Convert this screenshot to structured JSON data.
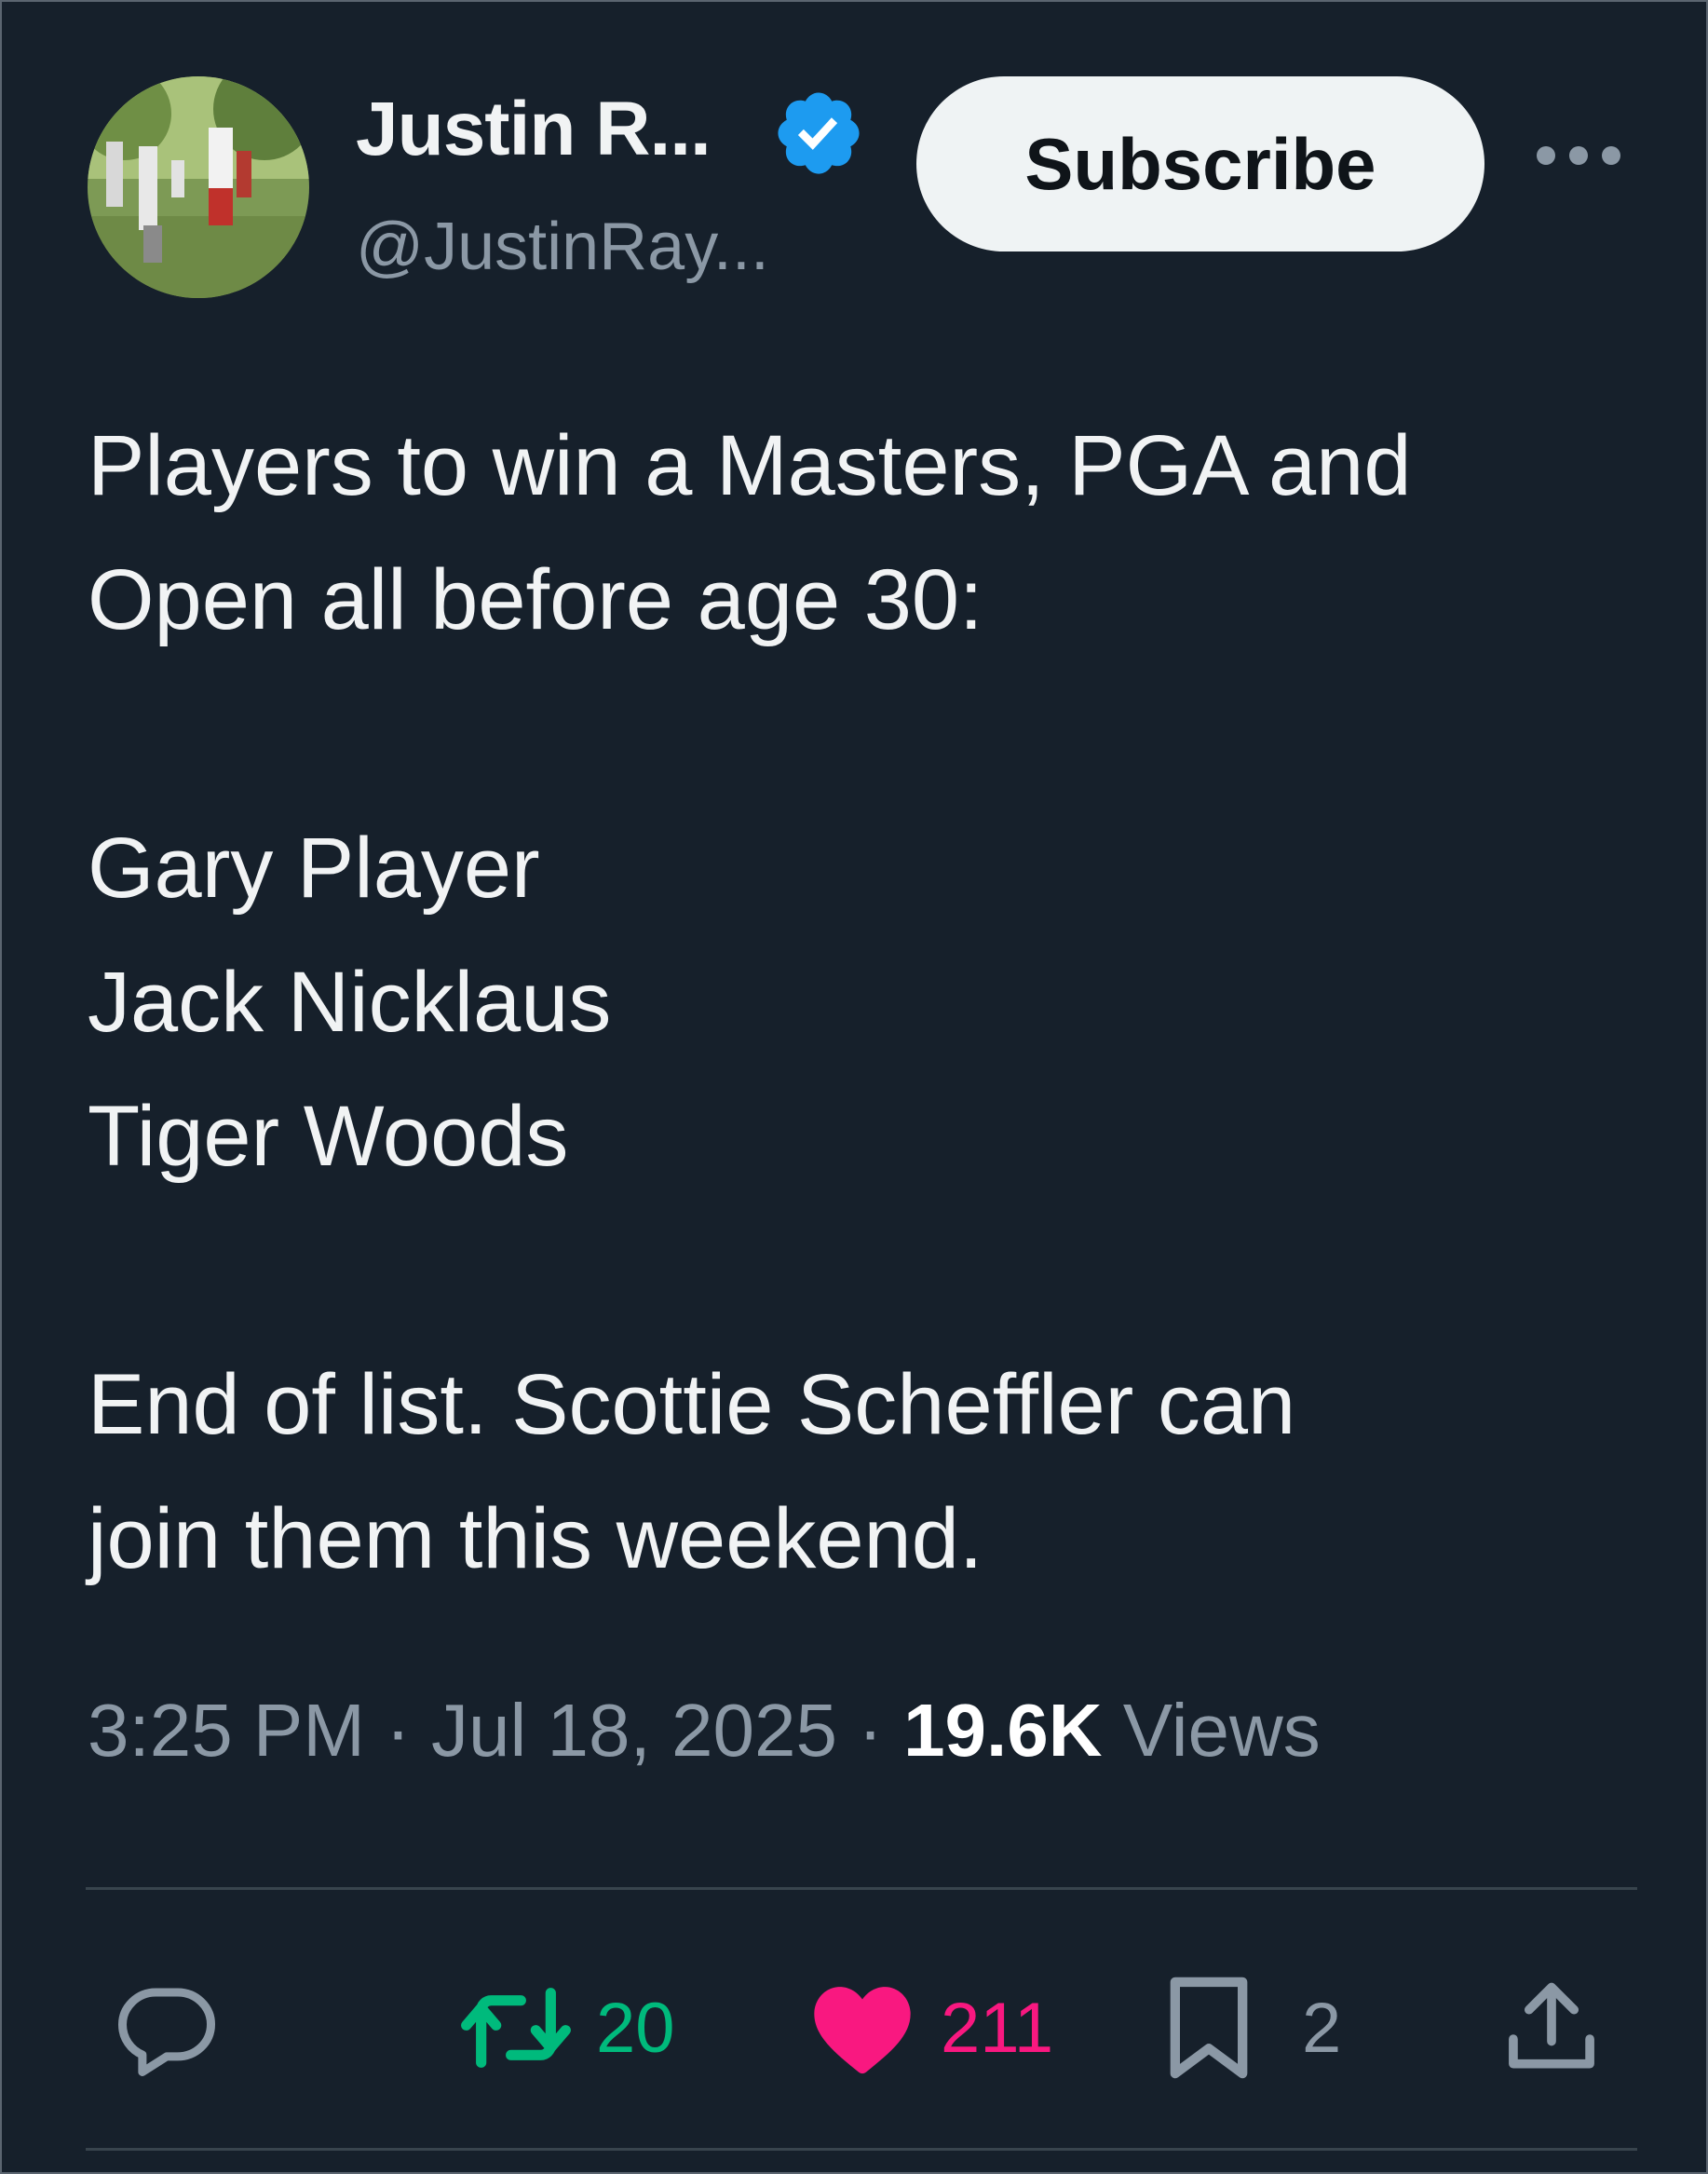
{
  "author": {
    "display_name": "Justin R...",
    "handle": "@JustinRay...",
    "verified": true
  },
  "header": {
    "subscribe_label": "Subscribe",
    "more_icon": "more-dots-icon"
  },
  "tweet": {
    "lines": [
      "Players to win a Masters, PGA and",
      "Open all before age 30:",
      "",
      "Gary Player",
      "Jack Nicklaus",
      "Tiger Woods",
      "",
      "End of list. Scottie Scheffler can",
      "join them this weekend."
    ]
  },
  "meta": {
    "time": "3:25 PM",
    "separator": "·",
    "date": "Jul 18, 2025",
    "views_count": "19.6K",
    "views_label": "Views"
  },
  "actions": {
    "reply": {
      "icon": "reply-icon",
      "count": ""
    },
    "retweet": {
      "icon": "retweet-icon",
      "count": "20"
    },
    "like": {
      "icon": "heart-icon",
      "count": "211"
    },
    "bookmark": {
      "icon": "bookmark-icon",
      "count": "2"
    },
    "share": {
      "icon": "share-icon"
    }
  },
  "colors": {
    "background": "#16202b",
    "text": "#f1f3f4",
    "muted": "#8b98a5",
    "verified": "#1d9bf0",
    "retweet": "#00ba7c",
    "like": "#f91880",
    "divider": "#38444d"
  }
}
